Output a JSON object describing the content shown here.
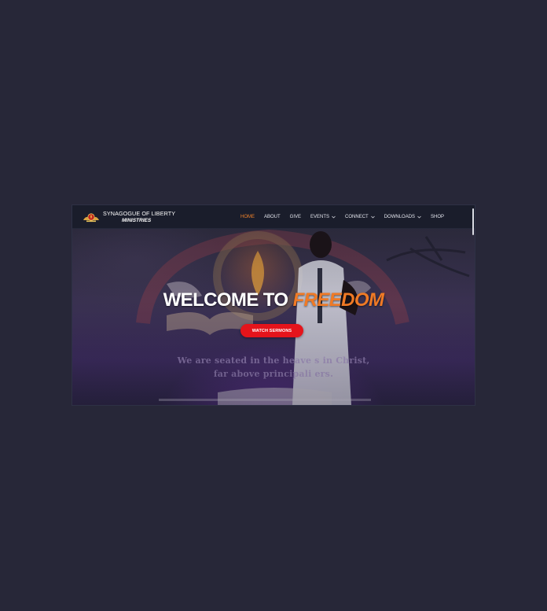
{
  "brand": {
    "line1": "SYNAGOGUE OF LIBERTY",
    "line2": "MINISTRIES",
    "logo_icon": "church-seal-icon"
  },
  "nav": {
    "items": [
      {
        "label": "HOME",
        "active": true,
        "dropdown": false
      },
      {
        "label": "ABOUT",
        "active": false,
        "dropdown": false
      },
      {
        "label": "GIVE",
        "active": false,
        "dropdown": false
      },
      {
        "label": "EVENTS",
        "active": false,
        "dropdown": true
      },
      {
        "label": "CONNECT",
        "active": false,
        "dropdown": true
      },
      {
        "label": "DOWNLOADS",
        "active": false,
        "dropdown": true
      },
      {
        "label": "SHOP",
        "active": false,
        "dropdown": false
      }
    ]
  },
  "hero": {
    "title_main": "WELCOME TO ",
    "title_accent": "FREEDOM",
    "button_label": "WATCH SERMONS",
    "verse_line1": "We are seated in the heave    s in Christ,",
    "verse_line2": "far above principali       ers."
  },
  "colors": {
    "page_bg": "#272738",
    "nav_bg": "#1a1d2b",
    "accent": "#f07a25",
    "button": "#e5141b"
  }
}
